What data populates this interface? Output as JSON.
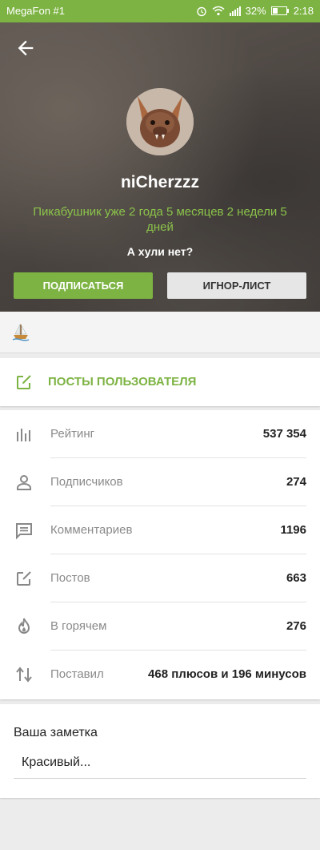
{
  "status_bar": {
    "carrier": "MegaFon #1",
    "battery": "32%",
    "time": "2:18",
    "icons": [
      "alarm-icon",
      "wifi-icon",
      "signal-icon",
      "battery-icon"
    ]
  },
  "profile": {
    "back_icon": "arrow-left-icon",
    "username": "niCherzzz",
    "tenure": "Пикабушник уже 2 года 5 месяцев 2 недели 5 дней",
    "motto": "А хули нет?",
    "subscribe_label": "ПОДПИСАТЬСЯ",
    "ignore_label": "ИГНОР-ЛИСТ"
  },
  "awards": [
    "ship-award-icon"
  ],
  "posts_link": {
    "icon": "edit-icon",
    "label": "ПОСТЫ ПОЛЬЗОВАТЕЛЯ"
  },
  "stats": [
    {
      "icon": "bar-chart-icon",
      "name": "Рейтинг",
      "value": "537 354"
    },
    {
      "icon": "person-icon",
      "name": "Подписчиков",
      "value": "274"
    },
    {
      "icon": "comment-icon",
      "name": "Комментариев",
      "value": "1196"
    },
    {
      "icon": "edit-icon",
      "name": "Постов",
      "value": "663"
    },
    {
      "icon": "flame-icon",
      "name": "В горячем",
      "value": "276"
    },
    {
      "icon": "swap-vertical-icon",
      "name": "Поставил",
      "value": "468 плюсов и 196 минусов"
    }
  ],
  "note": {
    "title": "Ваша заметка",
    "value": "Красивый..."
  },
  "colors": {
    "accent": "#7cb342",
    "tenure": "#8bc34a",
    "background": "#ececec"
  }
}
